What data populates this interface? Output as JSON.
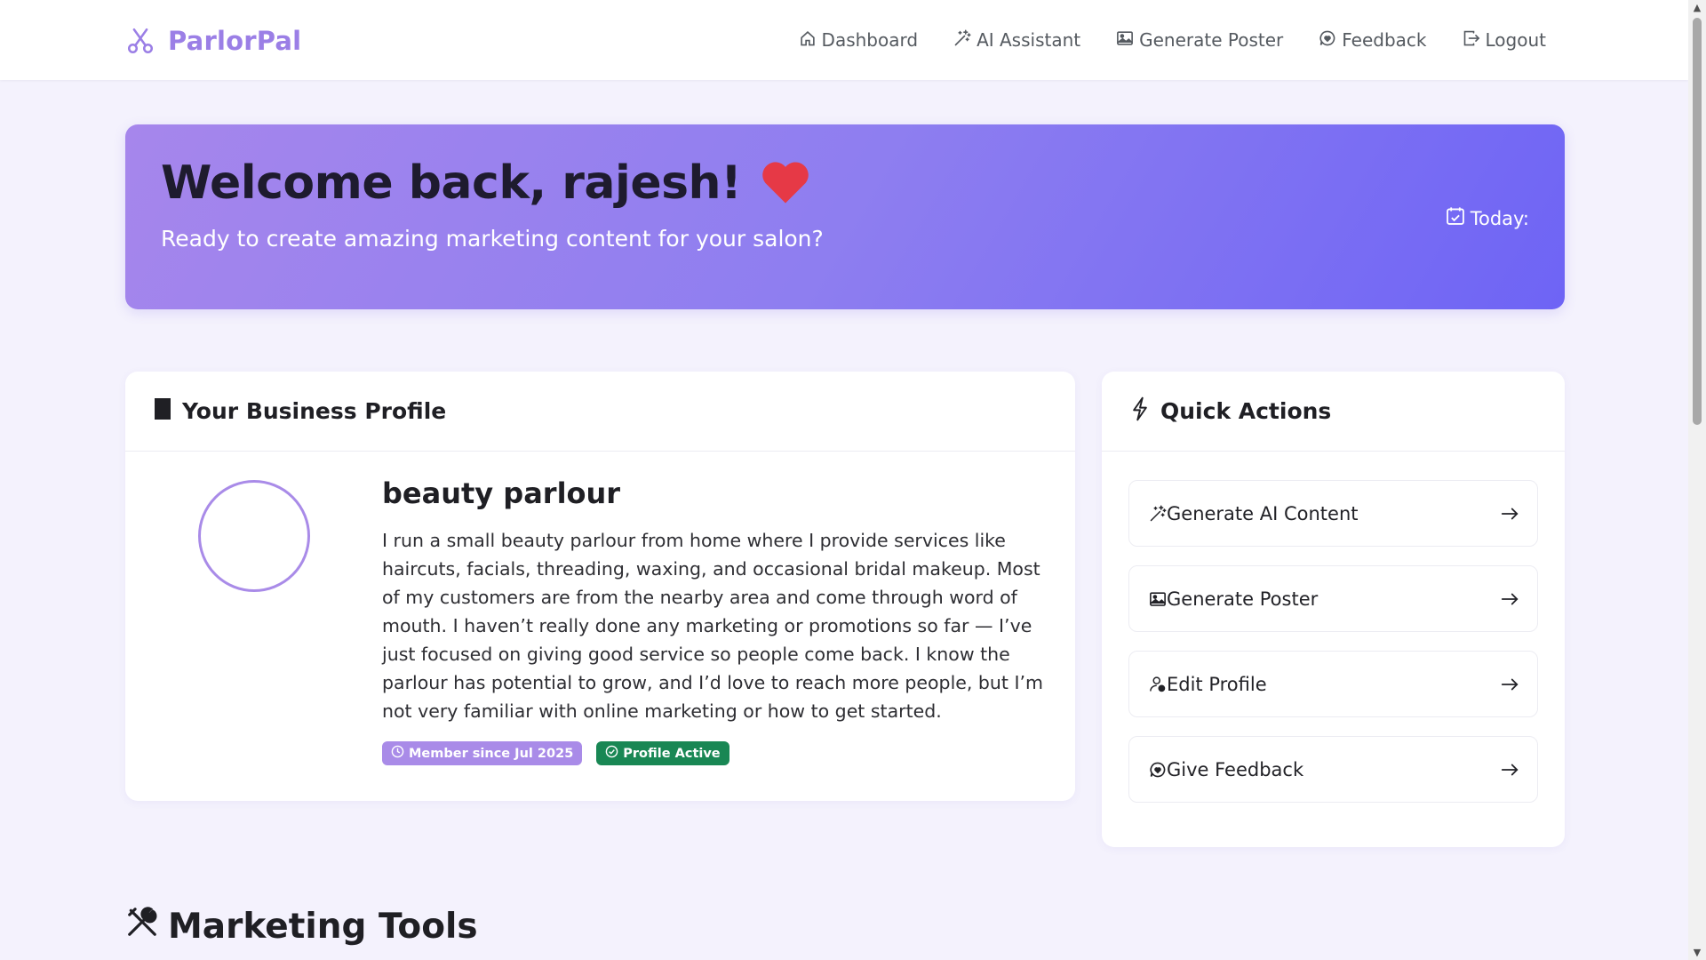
{
  "brand": {
    "name": "ParlorPal",
    "icon": "scissors-icon",
    "color": "#9b7fe6"
  },
  "nav": [
    {
      "label": "Dashboard",
      "icon": "house-icon"
    },
    {
      "label": "AI Assistant",
      "icon": "magic-wand-icon"
    },
    {
      "label": "Generate Poster",
      "icon": "image-icon"
    },
    {
      "label": "Feedback",
      "icon": "chat-heart-icon"
    },
    {
      "label": "Logout",
      "icon": "logout-icon"
    }
  ],
  "hero": {
    "title": "Welcome back, rajesh!",
    "icon": "heart-icon",
    "subtitle": "Ready to create amazing marketing content for your salon?",
    "today_label": "Today:"
  },
  "profile": {
    "header": "Your Business Profile",
    "name": "beauty parlour",
    "description": "I run a small beauty parlour from home where I provide services like haircuts, facials, threading, waxing, and occasional bridal makeup. Most of my customers are from the nearby area and come through word of mouth. I haven’t really done any marketing or promotions so far — I’ve just focused on giving good service so people come back. I know the parlour has potential to grow, and I’d love to reach more people, but I’m not very familiar with online marketing or how to get started.",
    "badges": {
      "member": "Member since Jul 2025",
      "status": "Profile Active"
    }
  },
  "quick_actions": {
    "header": "Quick Actions",
    "items": [
      {
        "label": "Generate AI Content",
        "icon": "magic-wand-icon"
      },
      {
        "label": "Generate Poster",
        "icon": "image-icon"
      },
      {
        "label": "Edit Profile",
        "icon": "person-gear-icon"
      },
      {
        "label": "Give Feedback",
        "icon": "chat-heart-icon"
      }
    ]
  },
  "marketing": {
    "title": "Marketing Tools",
    "icon": "tools-icon"
  },
  "colors": {
    "accent": "#9b7fe6",
    "hero_start": "#a686ec",
    "hero_end": "#6e64f5",
    "success": "#198754",
    "heart": "#e63946"
  }
}
